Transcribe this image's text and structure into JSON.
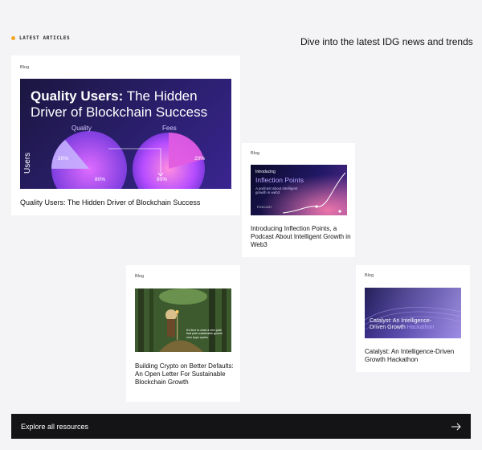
{
  "header": {
    "section_label": "LATEST ARTICLES",
    "tagline": "Dive into the latest IDG news and trends"
  },
  "cards": [
    {
      "category": "Blog",
      "title": "Quality Users: The Hidden Driver of Blockchain Success",
      "thumb": {
        "heading_strong": "Quality Users:",
        "heading_rest": "The Hidden Driver of Blockchain Success",
        "label_quality": "Quality",
        "label_fees": "Fees",
        "label_users": "Users",
        "pct_quality_small": "20%",
        "pct_quality_large": "80%",
        "pct_fees_small": "20%",
        "pct_fees_large": "80%"
      }
    },
    {
      "category": "Blog",
      "title": "Introducing Inflection Points, a Podcast About Intelligent Growth in Web3",
      "thumb": {
        "kicker": "Introducing",
        "heading": "Inflection Points",
        "subheading": "A podcast about intelligent growth in web3",
        "tag": "PODCAST"
      }
    },
    {
      "category": "Blog",
      "title": "Building Crypto on Better Defaults: An Open Letter For Sustainable Blockchain Growth",
      "thumb": {
        "text": "It's time to chart a new path that puts sustainable growth over hype cycles."
      }
    },
    {
      "category": "Blog",
      "title": "Catalyst: An Intelligence-Driven Growth Hackathon",
      "thumb": {
        "heading_line1": "Catalyst: An Intelligence-",
        "heading_line2_plain": "Driven Growth ",
        "heading_line2_accent": "Hackathon"
      }
    }
  ],
  "footer": {
    "explore_label": "Explore all resources",
    "arrow_icon": "arrow-right-icon"
  },
  "colors": {
    "background": "#f4f4f6",
    "accent_dot": "#f5a623",
    "button_bg": "#141416"
  }
}
